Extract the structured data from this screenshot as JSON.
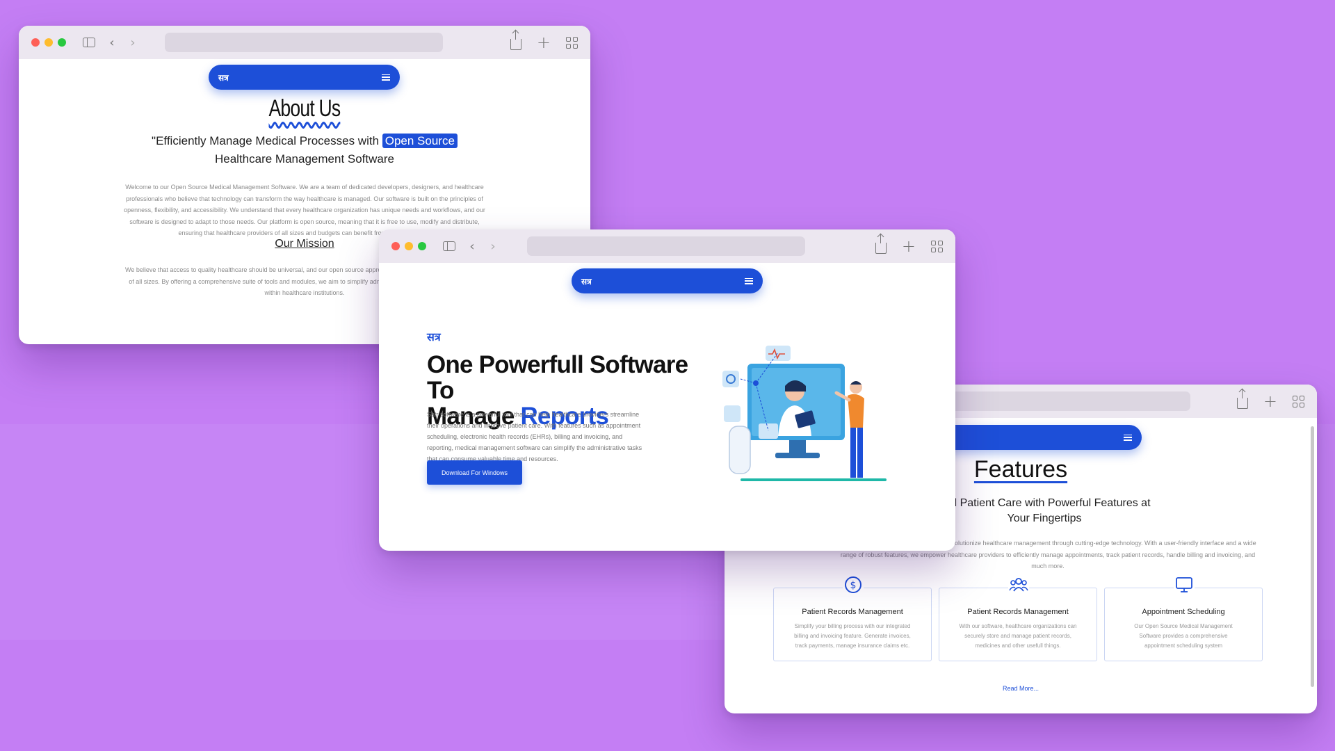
{
  "about_window": {
    "nav_logo": "सत्र",
    "title": "About Us",
    "subtitle_pre": "\"Efficiently Manage Medical Processes with ",
    "subtitle_highlight": "Open Source",
    "subtitle_post": " Healthcare Management Software",
    "intro": "Welcome to our Open Source Medical Management Software. We are a team of dedicated developers, designers, and healthcare professionals who believe that technology can transform the way healthcare is managed. Our software is built on the principles of openness, flexibility, and accessibility. We understand that every healthcare organization has unique needs and workflows, and our software is designed to adapt to those needs. Our platform is open source, meaning that it is free to use, modify and distribute, ensuring that healthcare providers of all sizes and budgets can benefit from our technology.",
    "mission_heading": "Our Mission",
    "mission_text": "We believe that access to quality healthcare should be universal, and our open source approach ensures affordable organizations of all sizes. By offering a comprehensive suite of tools and modules, we aim to simplify administrative improve overall efficiency within healthcare institutions."
  },
  "home_window": {
    "nav_logo": "सत्र",
    "brand": "सत्र",
    "hero_line1": "One Powerfull Software To",
    "hero_line2_pre": "Manage ",
    "hero_line2_highlight": "Reports",
    "description": "Satr software is a powerful tool that can help healthcare providers streamline their operations and improve patient care. With features such as appointment scheduling, electronic health records (EHRs), billing and invoicing, and reporting, medical management software can simplify the administrative tasks that can consume valuable time and resources.",
    "download_button": "Download For Windows"
  },
  "features_window": {
    "title": "Features",
    "subtitle": "and Patient Care with Powerful Features at Your Fingertips",
    "intro": "agement Software, where we strive to revolutionize healthcare management through cutting-edge technology. With a user-friendly interface and a wide range of robust features, we empower healthcare providers to efficiently manage appointments, track patient records, handle billing and invoicing, and much more.",
    "cards": [
      {
        "icon": "dollar-circle-icon",
        "title": "Patient Records Management",
        "text": "Simplify your billing process with our integrated billing and invoicing feature. Generate invoices, track payments, manage insurance claims etc."
      },
      {
        "icon": "users-icon",
        "title": "Patient Records Management",
        "text": "With our software, healthcare organizations can securely store and manage patient records, medicines and other usefull things."
      },
      {
        "icon": "monitor-icon",
        "title": "Appointment Scheduling",
        "text": "Our Open Source Medical Management Software provides a comprehensive appointment scheduling system"
      }
    ],
    "read_more": "Read More..."
  },
  "colors": {
    "background": "#c47ef4",
    "accent": "#1d4fd8"
  }
}
